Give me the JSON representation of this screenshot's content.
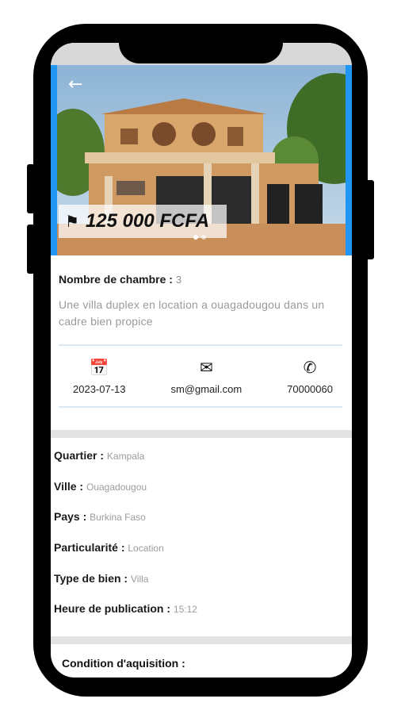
{
  "listing": {
    "price": "125 000 FCFA",
    "rooms_label": "Nombre de chambre :",
    "rooms_value": "3",
    "description": "Une villa duplex en location a ouagadougou dans un cadre bien propice",
    "date": "2023-07-13",
    "email": "sm@gmail.com",
    "phone": "70000060"
  },
  "details": [
    {
      "label": "Quartier :",
      "value": "Kampala"
    },
    {
      "label": "Ville :",
      "value": "Ouagadougou"
    },
    {
      "label": "Pays :",
      "value": "Burkina Faso"
    },
    {
      "label": "Particularité :",
      "value": "Location"
    },
    {
      "label": "Type de bien :",
      "value": "Villa"
    },
    {
      "label": "Heure de publication :",
      "value": "15:12"
    }
  ],
  "condition_label": "Condition d'aquisition :",
  "icons": {
    "back": "arrow-left-icon",
    "price": "tag-icon",
    "date": "calendar-icon",
    "email": "email-icon",
    "phone": "phone-icon"
  },
  "colors": {
    "accent": "#2196f3",
    "divider": "#dce9f3",
    "muted_text": "#9a9a9a"
  }
}
